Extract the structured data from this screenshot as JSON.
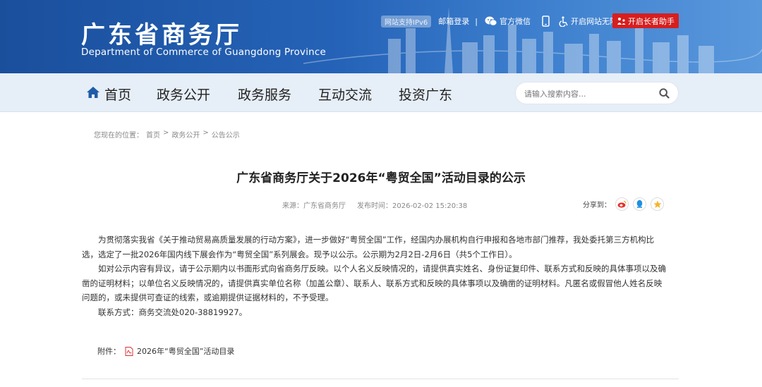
{
  "header": {
    "title": "广东省商务厅",
    "subtitle": "Department of Commerce of Guangdong Province",
    "ipv6_badge": "网站支持IPv6",
    "mail_login": "邮箱登录",
    "separator": "|",
    "wechat": "官方微信",
    "accessibility": "开启网站无障碍",
    "elder_mode": "开启长者助手"
  },
  "nav": {
    "items": [
      {
        "label": "首页"
      },
      {
        "label": "政务公开"
      },
      {
        "label": "政务服务"
      },
      {
        "label": "互动交流"
      },
      {
        "label": "投资广东"
      }
    ],
    "search_placeholder": "请输入搜索内容..."
  },
  "breadcrumb": {
    "prefix": "您现在的位置：",
    "items": [
      "首页",
      "政务公开",
      "公告公示"
    ],
    "sep": ">"
  },
  "article": {
    "title": "广东省商务厅关于2026年“粤贸全国”活动目录的公示",
    "source": "来源：广东省商务厅",
    "published": "发布时间：2026-02-02 15:20:38",
    "share_label": "分享到：",
    "paragraphs": [
      "为贯彻落实我省《关于推动贸易高质量发展的行动方案》，进一步做好“粤贸全国”工作，经国内办展机构自行申报和各地市部门推荐，我处委托第三方机构比选，选定了一批2026年国内线下展会作为“粤贸全国”系列展会。现予以公示。公示期为2月2日-2月6日（共5个工作日）。",
      "如对公示内容有异议，请于公示期内以书面形式向省商务厅反映。以个人名义反映情况的，请提供真实姓名、身份证复印件、联系方式和反映的具体事项以及确凿的证明材料；以单位名义反映情况的，请提供真实单位名称（加盖公章）、联系人、联系方式和反映的具体事项以及确凿的证明材料。凡匿名或假冒他人姓名反映问题的，或未提供可查证的线索，或逾期提供证据材料的，不予受理。",
      "联系方式：商务交流处020-38819927。"
    ],
    "attachment_label": "附件：",
    "attachment_name": "2026年“粤贸全国”活动目录"
  },
  "colors": {
    "banner": "#1a4f9c",
    "nav_bg": "#e6eef7",
    "elder_button": "#d61f1f"
  }
}
